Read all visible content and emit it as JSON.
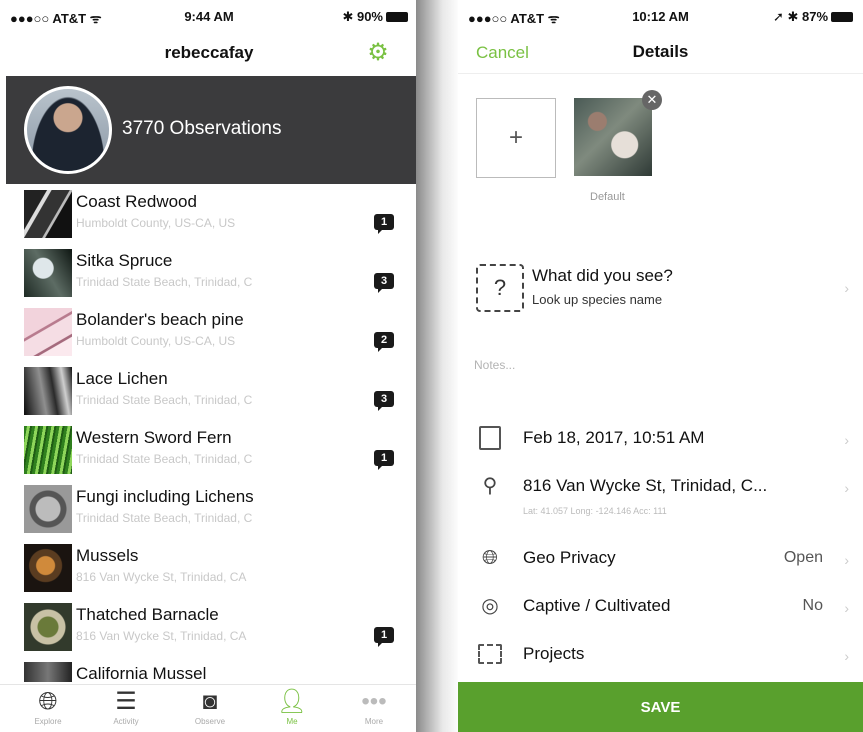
{
  "left_phone": {
    "status": {
      "carrier": "●●●○○ AT&T ᯤ",
      "time": "9:44 AM",
      "battery": "✱ 90%"
    },
    "nav": {
      "title": "rebeccafay",
      "settings_icon": "gear-icon"
    },
    "profile": {
      "observations": "3770 Observations"
    },
    "observations": [
      {
        "name": "Coast Redwood",
        "place": "Humboldt County, US-CA, US",
        "comments": "1"
      },
      {
        "name": "Sitka Spruce",
        "place": "Trinidad State Beach, Trinidad, C",
        "comments": "3"
      },
      {
        "name": "Bolander's beach pine",
        "place": "Humboldt County, US-CA, US",
        "comments": "2"
      },
      {
        "name": "Lace Lichen",
        "place": "Trinidad State Beach, Trinidad, C",
        "comments": "3"
      },
      {
        "name": "Western Sword Fern",
        "place": "Trinidad State Beach, Trinidad, C",
        "comments": "1"
      },
      {
        "name": "Fungi including Lichens",
        "place": "Trinidad State Beach, Trinidad, C",
        "comments": ""
      },
      {
        "name": "Mussels",
        "place": "816 Van Wycke St, Trinidad, CA",
        "comments": ""
      },
      {
        "name": "Thatched Barnacle",
        "place": "816 Van Wycke St, Trinidad, CA",
        "comments": "1"
      },
      {
        "name": "California Mussel",
        "place": "",
        "comments": ""
      }
    ],
    "tabs": [
      {
        "label": "Explore",
        "icon": "globe-icon"
      },
      {
        "label": "Activity",
        "icon": "list-icon"
      },
      {
        "label": "Observe",
        "icon": "camera-icon"
      },
      {
        "label": "Me",
        "icon": "person-icon"
      },
      {
        "label": "More",
        "icon": "more-icon"
      }
    ]
  },
  "right_phone": {
    "status": {
      "carrier": "●●●○○ AT&T ᯤ",
      "time": "10:12 AM",
      "battery": "➚ ✱ 87%"
    },
    "nav": {
      "cancel": "Cancel",
      "title": "Details"
    },
    "photos": {
      "add": "+",
      "default_label": "Default"
    },
    "species": {
      "prompt": "What did you see?",
      "lookup": "Look up species name"
    },
    "notes_placeholder": "Notes...",
    "date": "Feb 18, 2017, 10:51 AM",
    "location": {
      "address": "816 Van Wycke St, Trinidad, C...",
      "coords": "Lat: 41.057  Long: -124.146  Acc: 111"
    },
    "geo_privacy": {
      "label": "Geo Privacy",
      "value": "Open"
    },
    "captive": {
      "label": "Captive / Cultivated",
      "value": "No"
    },
    "projects": {
      "label": "Projects"
    },
    "save": "SAVE"
  },
  "colors": {
    "accent": "#7ac143",
    "save_bar": "#59a02d",
    "profile_bg": "#3b3b3d"
  }
}
